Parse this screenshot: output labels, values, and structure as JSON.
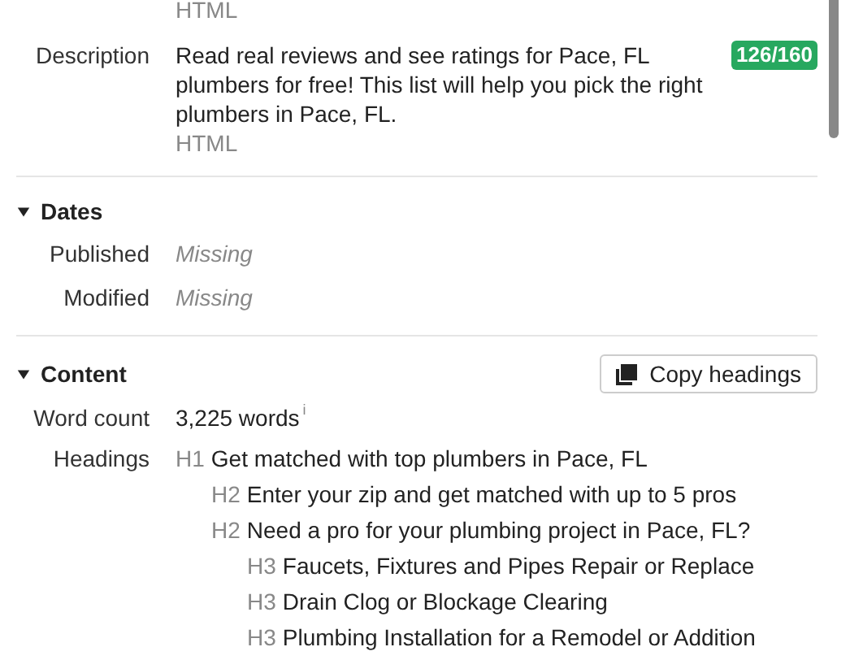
{
  "top_fragment": {
    "source": "HTML"
  },
  "description": {
    "label": "Description",
    "text": "Read real reviews and see ratings for Pace, FL plumbers for free! This list will help you pick the right plumbers in Pace, FL.",
    "source": "HTML",
    "badge": "126/160"
  },
  "dates": {
    "title": "Dates",
    "expanded": true,
    "rows": [
      {
        "label": "Published",
        "value": "Missing"
      },
      {
        "label": "Modified",
        "value": "Missing"
      }
    ]
  },
  "content": {
    "title": "Content",
    "expanded": true,
    "copy_button": "Copy headings",
    "word_count": {
      "label": "Word count",
      "value": "3,225 words",
      "info": "i"
    },
    "headings_label": "Headings",
    "headings": [
      {
        "tag": "H1",
        "text": "Get matched with top plumbers in Pace, FL",
        "children": [
          {
            "tag": "H2",
            "text": "Enter your zip and get matched with up to 5 pros"
          },
          {
            "tag": "H2",
            "text": "Need a pro for your plumbing project in Pace, FL?",
            "children": [
              {
                "tag": "H3",
                "text": "Faucets, Fixtures and Pipes Repair or Replace"
              },
              {
                "tag": "H3",
                "text": "Drain Clog or Blockage Clearing"
              },
              {
                "tag": "H3",
                "text": "Plumbing Installation for a Remodel or Addition"
              }
            ]
          }
        ]
      }
    ]
  }
}
